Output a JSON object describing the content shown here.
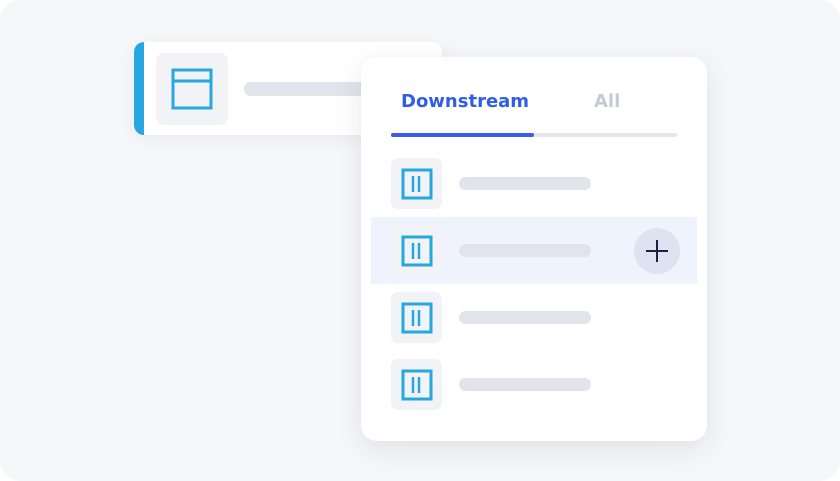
{
  "colors": {
    "accent_blue": "#27a7df",
    "tab_active": "#2f5ce9",
    "tab_inactive": "#c5cad8",
    "indicator": "#3d5cf0",
    "highlight_row": "#eff3fd",
    "placeholder": "#e1e4ea"
  },
  "back_card": {
    "icon": "window-icon"
  },
  "panel": {
    "tabs": [
      {
        "label": "Downstream",
        "active": true
      },
      {
        "label": "All",
        "active": false
      }
    ],
    "active_tab_progress": 0.5,
    "rows": [
      {
        "icon": "columns-icon",
        "highlighted": false
      },
      {
        "icon": "columns-icon",
        "highlighted": true,
        "action_icon": "plus-icon"
      },
      {
        "icon": "columns-icon",
        "highlighted": false
      },
      {
        "icon": "columns-icon",
        "highlighted": false
      }
    ]
  }
}
